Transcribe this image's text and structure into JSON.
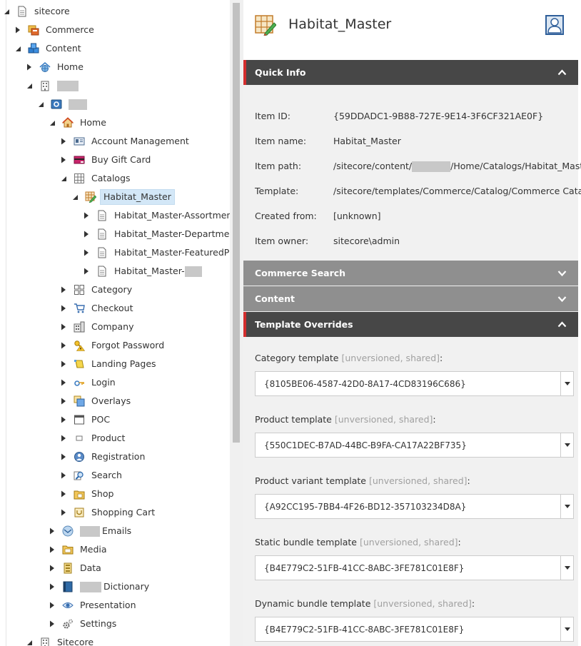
{
  "tree": {
    "rows": [
      {
        "label": "sitecore",
        "depth": 0,
        "toggle": "open",
        "icon": "page-icon"
      },
      {
        "label": "Commerce",
        "depth": 1,
        "toggle": "closed",
        "icon": "commerce-icon"
      },
      {
        "label": "Content",
        "depth": 1,
        "toggle": "open",
        "icon": "content-icon"
      },
      {
        "label": "Home",
        "depth": 2,
        "toggle": "closed",
        "icon": "home-globe-icon"
      },
      {
        "label": "",
        "depth": 2,
        "toggle": "open",
        "icon": "building-icon",
        "redact": true,
        "redactWidth": 30
      },
      {
        "label": "",
        "depth": 3,
        "toggle": "open",
        "icon": "site-icon",
        "redact": true,
        "redactWidth": 26
      },
      {
        "label": "Home",
        "depth": 4,
        "toggle": "open",
        "icon": "house-icon"
      },
      {
        "label": "Account Management",
        "depth": 5,
        "toggle": "closed",
        "icon": "account-icon"
      },
      {
        "label": "Buy Gift Card",
        "depth": 5,
        "toggle": "closed",
        "icon": "giftcard-icon"
      },
      {
        "label": "Catalogs",
        "depth": 5,
        "toggle": "open",
        "icon": "catalogs-icon"
      },
      {
        "label": "Habitat_Master",
        "depth": 6,
        "toggle": "open",
        "icon": "catalog-edit-icon",
        "selected": true
      },
      {
        "label": "Habitat_Master-Assortments",
        "depth": 7,
        "toggle": "closed",
        "icon": "page-icon"
      },
      {
        "label": "Habitat_Master-Departments",
        "depth": 7,
        "toggle": "closed",
        "icon": "page-icon"
      },
      {
        "label": "Habitat_Master-FeaturedProducts",
        "depth": 7,
        "toggle": "closed",
        "icon": "page-icon"
      },
      {
        "label": "Habitat_Master-",
        "depth": 7,
        "toggle": "closed",
        "icon": "page-icon",
        "redactAfter": true,
        "redactWidth": 24
      },
      {
        "label": "Category",
        "depth": 5,
        "toggle": "closed",
        "icon": "category-icon"
      },
      {
        "label": "Checkout",
        "depth": 5,
        "toggle": "closed",
        "icon": "checkout-icon"
      },
      {
        "label": "Company",
        "depth": 5,
        "toggle": "closed",
        "icon": "company-icon"
      },
      {
        "label": "Forgot Password",
        "depth": 5,
        "toggle": "closed",
        "icon": "key-warning-icon"
      },
      {
        "label": "Landing Pages",
        "depth": 5,
        "toggle": "closed",
        "icon": "landing-icon"
      },
      {
        "label": "Login",
        "depth": 5,
        "toggle": "closed",
        "icon": "login-icon"
      },
      {
        "label": "Overlays",
        "depth": 5,
        "toggle": "closed",
        "icon": "overlays-icon"
      },
      {
        "label": "POC",
        "depth": 5,
        "toggle": "closed",
        "icon": "window-icon"
      },
      {
        "label": "Product",
        "depth": 5,
        "toggle": "closed",
        "icon": "product-icon"
      },
      {
        "label": "Registration",
        "depth": 5,
        "toggle": "closed",
        "icon": "registration-icon"
      },
      {
        "label": "Search",
        "depth": 5,
        "toggle": "closed",
        "icon": "search-icon"
      },
      {
        "label": "Shop",
        "depth": 5,
        "toggle": "closed",
        "icon": "shop-icon"
      },
      {
        "label": "Shopping Cart",
        "depth": 5,
        "toggle": "closed",
        "icon": "cart-icon"
      },
      {
        "label": "Emails",
        "depth": 4,
        "toggle": "closed",
        "icon": "emails-icon",
        "redactBefore": true,
        "redactWidth": 28
      },
      {
        "label": "Media",
        "depth": 4,
        "toggle": "closed",
        "icon": "media-folder-icon"
      },
      {
        "label": "Data",
        "depth": 4,
        "toggle": "closed",
        "icon": "data-icon"
      },
      {
        "label": "Dictionary",
        "depth": 4,
        "toggle": "closed",
        "icon": "dictionary-icon",
        "redactBefore": true,
        "redactWidth": 30
      },
      {
        "label": "Presentation",
        "depth": 4,
        "toggle": "closed",
        "icon": "presentation-icon"
      },
      {
        "label": "Settings",
        "depth": 4,
        "toggle": "closed",
        "icon": "settings-icon"
      },
      {
        "label": "Sitecore",
        "depth": 2,
        "toggle": "open",
        "icon": "building-icon"
      }
    ]
  },
  "header": {
    "title": "Habitat_Master",
    "icon": "catalog-edit-icon"
  },
  "quick_info": {
    "title": "Quick Info",
    "rows": [
      {
        "k": "Item ID:",
        "v": "{59DDADC1-9B88-727E-9E14-3F6CF321AE0F}"
      },
      {
        "k": "Item name:",
        "v": "Habitat_Master"
      },
      {
        "k": "Item path:",
        "v": "/sitecore/content/",
        "v2": "/Home/Catalogs/Habitat_Master",
        "redact": true
      },
      {
        "k": "Template:",
        "v": "/sitecore/templates/Commerce/Catalog/Commerce Catalog - Catalog"
      },
      {
        "k": "Created from:",
        "v": "[unknown]"
      },
      {
        "k": "Item owner:",
        "v": "sitecore\\admin"
      }
    ]
  },
  "sections": {
    "commerce_search": "Commerce Search",
    "content": "Content",
    "template_overrides": "Template Overrides"
  },
  "fields": [
    {
      "label": "Category template",
      "meta": "[unversioned, shared]",
      "value": "{8105BE06-4587-42D0-8A17-4CD83196C686}"
    },
    {
      "label": "Product template",
      "meta": "[unversioned, shared]",
      "value": "{550C1DEC-B7AD-44BC-B9FA-CA17A22BF735}"
    },
    {
      "label": "Product variant template",
      "meta": "[unversioned, shared]",
      "value": "{A92CC195-7BB4-4F26-BD12-357103234D8A}"
    },
    {
      "label": "Static bundle template",
      "meta": "[unversioned, shared]",
      "value": "{B4E779C2-51FB-41CC-8ABC-3FE781C01E8F}"
    },
    {
      "label": "Dynamic bundle template",
      "meta": "[unversioned, shared]",
      "value": "{B4E779C2-51FB-41CC-8ABC-3FE781C01E8F}"
    }
  ],
  "colors": {
    "accent": "#d22d2d",
    "section_open": "#474747",
    "section_closed": "#8f8f8f",
    "selected": "#d3e7f7"
  }
}
